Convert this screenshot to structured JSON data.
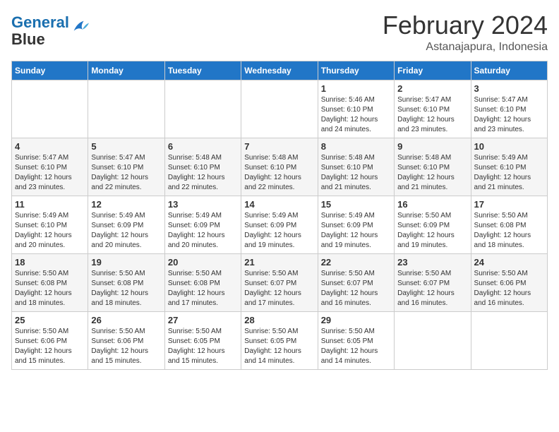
{
  "header": {
    "logo_line1": "General",
    "logo_line2": "Blue",
    "month": "February 2024",
    "location": "Astanajapura, Indonesia"
  },
  "weekdays": [
    "Sunday",
    "Monday",
    "Tuesday",
    "Wednesday",
    "Thursday",
    "Friday",
    "Saturday"
  ],
  "weeks": [
    [
      {
        "day": "",
        "info": ""
      },
      {
        "day": "",
        "info": ""
      },
      {
        "day": "",
        "info": ""
      },
      {
        "day": "",
        "info": ""
      },
      {
        "day": "1",
        "info": "Sunrise: 5:46 AM\nSunset: 6:10 PM\nDaylight: 12 hours\nand 24 minutes."
      },
      {
        "day": "2",
        "info": "Sunrise: 5:47 AM\nSunset: 6:10 PM\nDaylight: 12 hours\nand 23 minutes."
      },
      {
        "day": "3",
        "info": "Sunrise: 5:47 AM\nSunset: 6:10 PM\nDaylight: 12 hours\nand 23 minutes."
      }
    ],
    [
      {
        "day": "4",
        "info": "Sunrise: 5:47 AM\nSunset: 6:10 PM\nDaylight: 12 hours\nand 23 minutes."
      },
      {
        "day": "5",
        "info": "Sunrise: 5:47 AM\nSunset: 6:10 PM\nDaylight: 12 hours\nand 22 minutes."
      },
      {
        "day": "6",
        "info": "Sunrise: 5:48 AM\nSunset: 6:10 PM\nDaylight: 12 hours\nand 22 minutes."
      },
      {
        "day": "7",
        "info": "Sunrise: 5:48 AM\nSunset: 6:10 PM\nDaylight: 12 hours\nand 22 minutes."
      },
      {
        "day": "8",
        "info": "Sunrise: 5:48 AM\nSunset: 6:10 PM\nDaylight: 12 hours\nand 21 minutes."
      },
      {
        "day": "9",
        "info": "Sunrise: 5:48 AM\nSunset: 6:10 PM\nDaylight: 12 hours\nand 21 minutes."
      },
      {
        "day": "10",
        "info": "Sunrise: 5:49 AM\nSunset: 6:10 PM\nDaylight: 12 hours\nand 21 minutes."
      }
    ],
    [
      {
        "day": "11",
        "info": "Sunrise: 5:49 AM\nSunset: 6:10 PM\nDaylight: 12 hours\nand 20 minutes."
      },
      {
        "day": "12",
        "info": "Sunrise: 5:49 AM\nSunset: 6:09 PM\nDaylight: 12 hours\nand 20 minutes."
      },
      {
        "day": "13",
        "info": "Sunrise: 5:49 AM\nSunset: 6:09 PM\nDaylight: 12 hours\nand 20 minutes."
      },
      {
        "day": "14",
        "info": "Sunrise: 5:49 AM\nSunset: 6:09 PM\nDaylight: 12 hours\nand 19 minutes."
      },
      {
        "day": "15",
        "info": "Sunrise: 5:49 AM\nSunset: 6:09 PM\nDaylight: 12 hours\nand 19 minutes."
      },
      {
        "day": "16",
        "info": "Sunrise: 5:50 AM\nSunset: 6:09 PM\nDaylight: 12 hours\nand 19 minutes."
      },
      {
        "day": "17",
        "info": "Sunrise: 5:50 AM\nSunset: 6:08 PM\nDaylight: 12 hours\nand 18 minutes."
      }
    ],
    [
      {
        "day": "18",
        "info": "Sunrise: 5:50 AM\nSunset: 6:08 PM\nDaylight: 12 hours\nand 18 minutes."
      },
      {
        "day": "19",
        "info": "Sunrise: 5:50 AM\nSunset: 6:08 PM\nDaylight: 12 hours\nand 18 minutes."
      },
      {
        "day": "20",
        "info": "Sunrise: 5:50 AM\nSunset: 6:08 PM\nDaylight: 12 hours\nand 17 minutes."
      },
      {
        "day": "21",
        "info": "Sunrise: 5:50 AM\nSunset: 6:07 PM\nDaylight: 12 hours\nand 17 minutes."
      },
      {
        "day": "22",
        "info": "Sunrise: 5:50 AM\nSunset: 6:07 PM\nDaylight: 12 hours\nand 16 minutes."
      },
      {
        "day": "23",
        "info": "Sunrise: 5:50 AM\nSunset: 6:07 PM\nDaylight: 12 hours\nand 16 minutes."
      },
      {
        "day": "24",
        "info": "Sunrise: 5:50 AM\nSunset: 6:06 PM\nDaylight: 12 hours\nand 16 minutes."
      }
    ],
    [
      {
        "day": "25",
        "info": "Sunrise: 5:50 AM\nSunset: 6:06 PM\nDaylight: 12 hours\nand 15 minutes."
      },
      {
        "day": "26",
        "info": "Sunrise: 5:50 AM\nSunset: 6:06 PM\nDaylight: 12 hours\nand 15 minutes."
      },
      {
        "day": "27",
        "info": "Sunrise: 5:50 AM\nSunset: 6:05 PM\nDaylight: 12 hours\nand 15 minutes."
      },
      {
        "day": "28",
        "info": "Sunrise: 5:50 AM\nSunset: 6:05 PM\nDaylight: 12 hours\nand 14 minutes."
      },
      {
        "day": "29",
        "info": "Sunrise: 5:50 AM\nSunset: 6:05 PM\nDaylight: 12 hours\nand 14 minutes."
      },
      {
        "day": "",
        "info": ""
      },
      {
        "day": "",
        "info": ""
      }
    ]
  ]
}
